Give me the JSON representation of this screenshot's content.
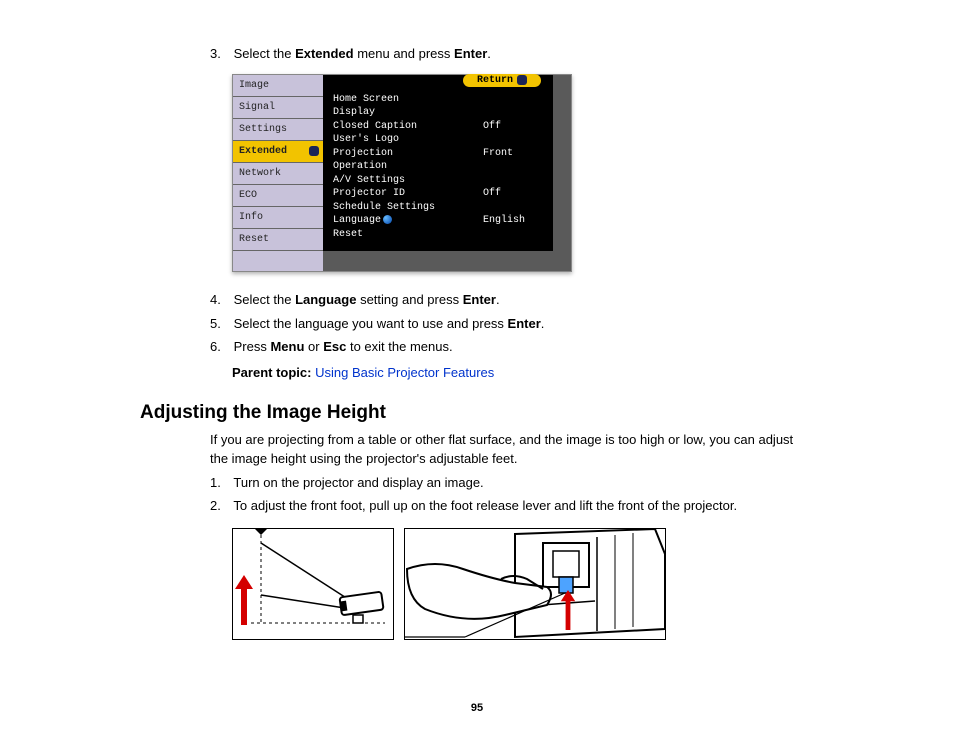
{
  "steps_top": [
    {
      "n": "3.",
      "pre": "Select the ",
      "b1": "Extended",
      "mid": " menu and press ",
      "b2": "Enter",
      "post": "."
    }
  ],
  "osd": {
    "tabs": [
      "Image",
      "Signal",
      "Settings",
      "Extended",
      "Network",
      "ECO",
      "Info",
      "Reset"
    ],
    "selected_tab": "Extended",
    "return_label": "Return",
    "items": [
      {
        "k": "Home Screen",
        "v": ""
      },
      {
        "k": "Display",
        "v": ""
      },
      {
        "k": "Closed Caption",
        "v": "Off"
      },
      {
        "k": "User's Logo",
        "v": ""
      },
      {
        "k": "Projection",
        "v": "Front"
      },
      {
        "k": "Operation",
        "v": ""
      },
      {
        "k": "A/V Settings",
        "v": ""
      },
      {
        "k": "Projector ID",
        "v": "Off"
      },
      {
        "k": "Schedule Settings",
        "v": ""
      },
      {
        "k": "Language",
        "v": "English",
        "globe": true
      },
      {
        "k": "Reset",
        "v": ""
      }
    ]
  },
  "steps_bottom": [
    {
      "n": "4.",
      "pre": "Select the ",
      "b1": "Language",
      "mid": " setting and press ",
      "b2": "Enter",
      "post": "."
    },
    {
      "n": "5.",
      "pre": "Select the language you want to use and press ",
      "b1": "Enter",
      "mid": "",
      "b2": "",
      "post": "."
    },
    {
      "n": "6.",
      "pre": "Press ",
      "b1": "Menu",
      "mid": " or ",
      "b2": "Esc",
      "post": " to exit the menus."
    }
  ],
  "parent_topic_label": "Parent topic:",
  "parent_topic_link": "Using Basic Projector Features",
  "heading": "Adjusting the Image Height",
  "intro": "If you are projecting from a table or other flat surface, and the image is too high or low, you can adjust the image height using the projector's adjustable feet.",
  "steps_section2": [
    {
      "n": "1.",
      "text": "Turn on the projector and display an image."
    },
    {
      "n": "2.",
      "text": "To adjust the front foot, pull up on the foot release lever and lift the front of the projector."
    }
  ],
  "page_number": "95"
}
